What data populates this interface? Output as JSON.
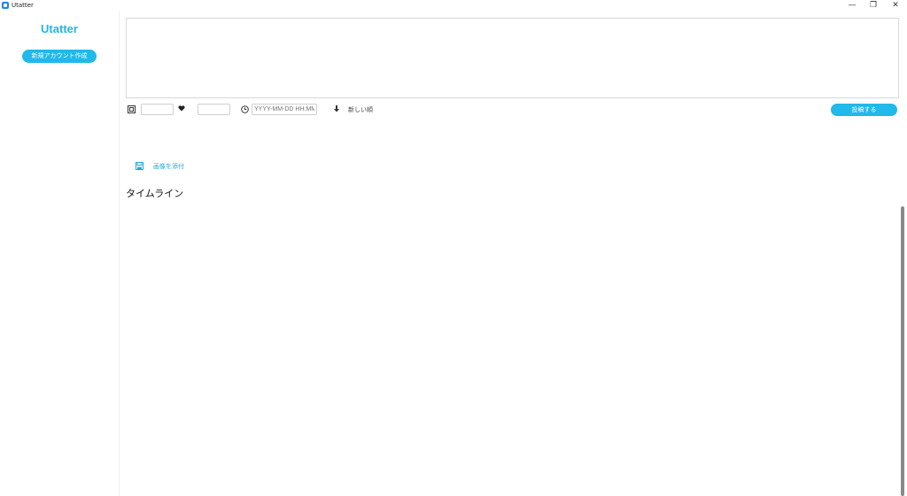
{
  "window": {
    "title": "Utatter",
    "minimize": "—",
    "maximize": "❐",
    "close": "✕"
  },
  "sidebar": {
    "brand": "Utatter",
    "signup_button": "新規アカウント作成"
  },
  "composer": {
    "text": "",
    "image_icon": "image-icon",
    "like_icon": "heart-icon",
    "clock_icon": "clock-icon",
    "datetime_placeholder": "YYYY-MM-DD HH:MM",
    "sort_icon": "arrow-down-icon",
    "sort_label": "新しい順",
    "post_button": "投稿する"
  },
  "attach": {
    "label": "画像を添付"
  },
  "timeline": {
    "heading": "タイムライン"
  },
  "colors": {
    "accent": "#21b8ea",
    "brand": "#1fb6e8"
  }
}
